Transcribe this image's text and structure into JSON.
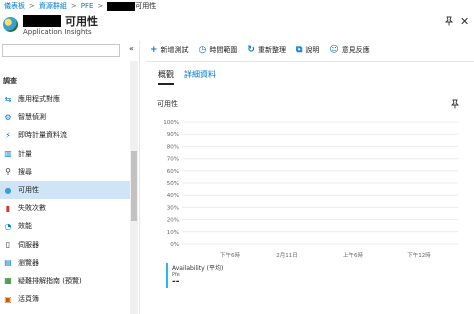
{
  "breadcrumb": {
    "items": [
      "儀表板",
      "資源群組",
      "PFE"
    ],
    "current": "可用性"
  },
  "header": {
    "title": "可用性",
    "subtitle": "Application Insights"
  },
  "sidebar": {
    "section": "調查",
    "items": [
      {
        "label": "應用程式對應",
        "icon": "app-map-icon"
      },
      {
        "label": "智慧偵測",
        "icon": "smart-detection-icon"
      },
      {
        "label": "即時計量資料流",
        "icon": "live-metrics-icon"
      },
      {
        "label": "計量",
        "icon": "metrics-icon"
      },
      {
        "label": "搜尋",
        "icon": "search-icon"
      },
      {
        "label": "可用性",
        "icon": "availability-icon",
        "active": true
      },
      {
        "label": "失敗次數",
        "icon": "failures-icon"
      },
      {
        "label": "效能",
        "icon": "performance-icon"
      },
      {
        "label": "伺服器",
        "icon": "servers-icon"
      },
      {
        "label": "瀏覽器",
        "icon": "browser-icon"
      },
      {
        "label": "疑難排解指南 (預覽)",
        "icon": "troubleshooting-icon"
      },
      {
        "label": "活頁簿",
        "icon": "workbooks-icon"
      }
    ]
  },
  "toolbar": {
    "add_test": "新增測試",
    "time_range": "時間範圍",
    "refresh": "重新整理",
    "help": "說明",
    "feedback": "意見反應"
  },
  "tabs": [
    {
      "label": "概觀",
      "active": true
    },
    {
      "label": "詳細資料",
      "active": false
    }
  ],
  "panel": {
    "title": "可用性"
  },
  "chart_data": {
    "type": "line",
    "y_ticks": [
      "100%",
      "90%",
      "80%",
      "70%",
      "60%",
      "50%",
      "40%",
      "30%",
      "20%",
      "10%",
      "0%"
    ],
    "x_ticks": [
      "下午6時",
      "2月11日",
      "上午6時",
      "下午12時"
    ],
    "series": [],
    "ylim": [
      0,
      100
    ],
    "grid": true
  },
  "legend": {
    "name": "Availability (平均)",
    "sub": "Pfe",
    "value": "--"
  },
  "colors": {
    "accent": "#0078d4",
    "legend_bar": "#29b6f6",
    "active_item": "#cfe5f7"
  }
}
